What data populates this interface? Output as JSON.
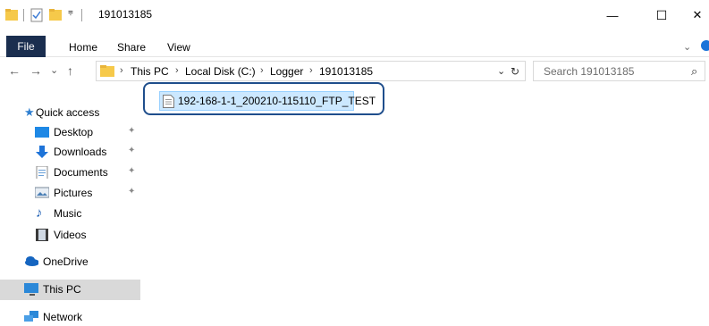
{
  "window": {
    "title": "191013185",
    "minimize": "—",
    "maximize": "☐",
    "close": "✕"
  },
  "ribbon": {
    "tabs": [
      {
        "label": "File"
      },
      {
        "label": "Home"
      },
      {
        "label": "Share"
      },
      {
        "label": "View"
      }
    ]
  },
  "address": {
    "back": "←",
    "forward": "→",
    "recent": "⌄",
    "up": "↑",
    "breadcrumbs": [
      "This PC",
      "Local Disk (C:)",
      "Logger",
      "191013185"
    ],
    "separator": "›",
    "dropdown": "⌄",
    "refresh": "↻"
  },
  "search": {
    "placeholder": "Search 191013185",
    "icon": "⌕"
  },
  "nav": {
    "quick_access": "Quick access",
    "items": [
      {
        "label": "Desktop",
        "icon": "desktop-icon",
        "pinned": true
      },
      {
        "label": "Downloads",
        "icon": "download-icon",
        "pinned": true
      },
      {
        "label": "Documents",
        "icon": "documents-icon",
        "pinned": true
      },
      {
        "label": "Pictures",
        "icon": "pictures-icon",
        "pinned": true
      },
      {
        "label": "Music",
        "icon": "music-icon",
        "pinned": false
      },
      {
        "label": "Videos",
        "icon": "videos-icon",
        "pinned": false
      }
    ],
    "onedrive": "OneDrive",
    "this_pc": "This PC",
    "network": "Network",
    "pin_glyph": "✦"
  },
  "files": [
    {
      "name": "192-168-1-1_200210-115110_FTP_TEST",
      "selected": true
    }
  ],
  "colors": {
    "file_tab": "#1a2e4f",
    "selection": "#cce8ff",
    "highlight_border": "#1f4e8c"
  }
}
